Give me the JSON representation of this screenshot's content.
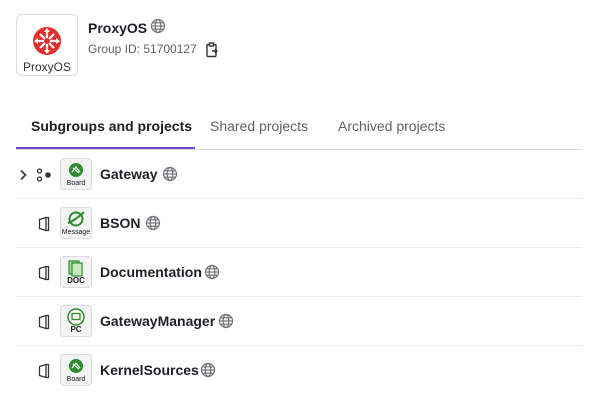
{
  "group": {
    "logo_text": "ProxyOS",
    "name": "ProxyOS",
    "id_text": "Group ID: 51700127"
  },
  "tabs": [
    {
      "label": "Subgroups and projects",
      "active": true
    },
    {
      "label": "Shared projects",
      "active": false
    },
    {
      "label": "Archived projects",
      "active": false
    }
  ],
  "items": [
    {
      "name": "Gateway",
      "kind": "subgroup",
      "avatar_label": "Board",
      "avatar_icon": "board-icon",
      "visibility": "public"
    },
    {
      "name": "BSON",
      "kind": "project",
      "avatar_label": "Message",
      "avatar_icon": "message-icon",
      "visibility": "public"
    },
    {
      "name": "Documentation",
      "kind": "project",
      "avatar_label": "DOC",
      "avatar_icon": "doc-icon",
      "visibility": "public"
    },
    {
      "name": "GatewayManager",
      "kind": "project",
      "avatar_label": "PC",
      "avatar_icon": "pc-icon",
      "visibility": "public"
    },
    {
      "name": "KernelSources",
      "kind": "project",
      "avatar_label": "Board",
      "avatar_icon": "board-icon",
      "visibility": "public"
    }
  ],
  "colors": {
    "accent": "#6e49cb",
    "logo_red": "#e52d2d",
    "avatar_green": "#2e8b2e"
  }
}
